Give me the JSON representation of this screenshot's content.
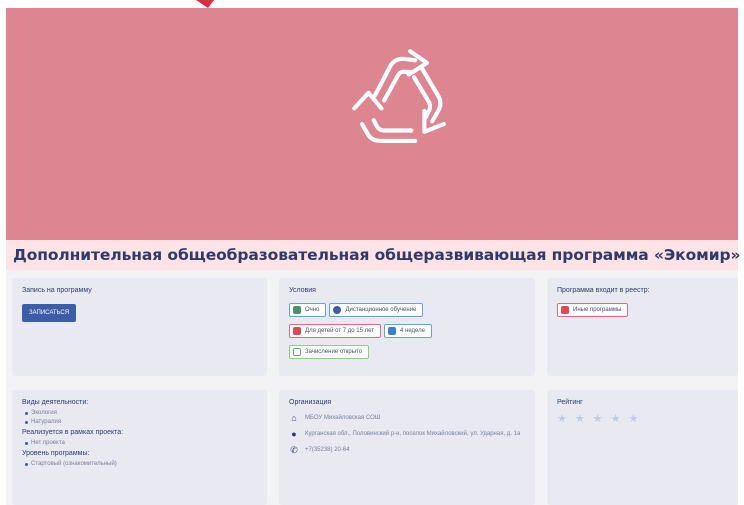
{
  "hero": {
    "color": "#de8592",
    "icon": "recycle-icon"
  },
  "program": {
    "title": "Дополнительная общеобразовательная общеразвивающая программа «Экомир»"
  },
  "enroll": {
    "label": "Запись на программу",
    "button": "записаться"
  },
  "conditions": {
    "label": "Условия",
    "chips": [
      {
        "icon": "school-icon",
        "text": "Очно"
      },
      {
        "icon": "distance-icon",
        "text": "Дистанционное обучение"
      },
      {
        "icon": "age-icon",
        "text": "Для детей от 7 до 15 лет"
      },
      {
        "icon": "calendar-icon",
        "text": "4 неделе"
      },
      {
        "icon": "lock-icon",
        "text": "Зачисление открыто"
      }
    ]
  },
  "registry": {
    "label": "Программа входит в реестр:",
    "badge": "Иные программы"
  },
  "activities": {
    "label": "Виды деятельности:",
    "items": [
      "Экология",
      "Натуралия"
    ],
    "project_label": "Реализуется в рамках проекта:",
    "projects": [
      "Нет проекта"
    ],
    "levels_label": "Уровень программы:",
    "levels": [
      "Стартовый (ознакомительный)"
    ]
  },
  "organization": {
    "label": "Организация",
    "name": "МБОУ Михайловская СОШ",
    "address": "Курганская обл., Половинский р-н, поселок Михайловский, ул. Ударная, д. 1а",
    "phone": "+7(35238) 20-64"
  },
  "rating": {
    "label": "Рейтинг",
    "stars": 5,
    "filled": 0
  }
}
